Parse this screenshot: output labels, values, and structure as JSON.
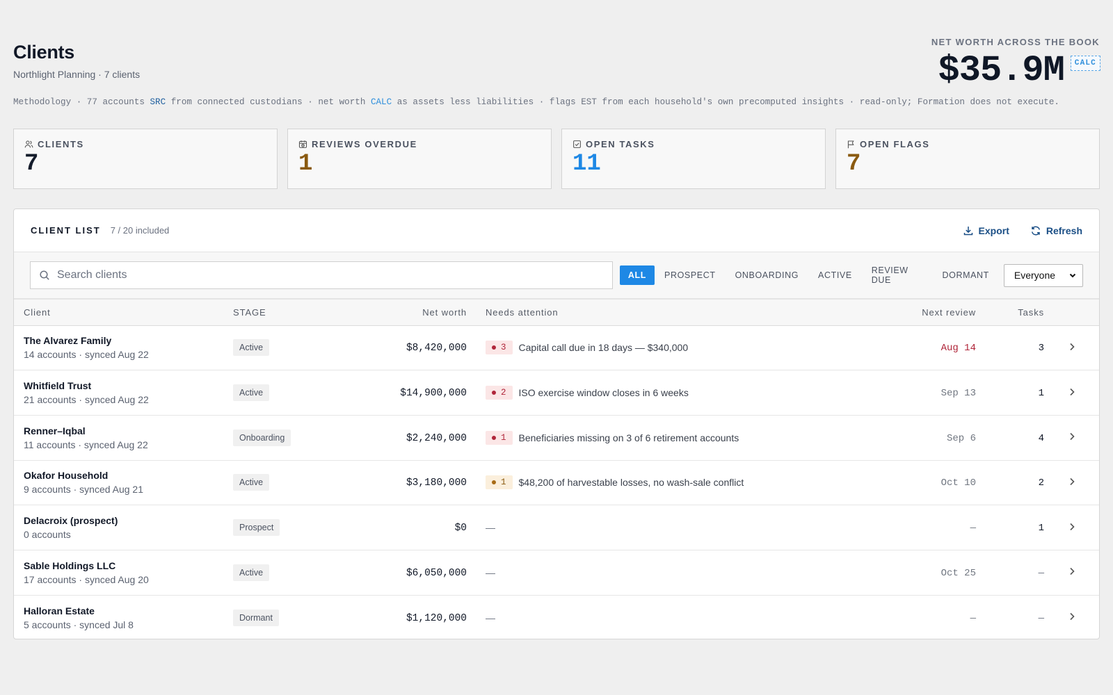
{
  "header": {
    "title": "Clients",
    "subtitle": "Northlight Planning · 7 clients",
    "hero_label": "NET WORTH ACROSS THE BOOK",
    "hero_value": "$35.9M",
    "hero_badge": "CALC"
  },
  "methodology": {
    "part1": "Methodology · 77 accounts ",
    "src": "SRC",
    "part2": " from connected custodians · net worth ",
    "calc": "CALC",
    "part3": " as assets less liabilities · flags EST from each household's own precomputed insights · read-only; Formation does not execute."
  },
  "kpis": [
    {
      "label": "CLIENTS",
      "value": "7",
      "icon": "people-icon",
      "color": "#111827"
    },
    {
      "label": "REVIEWS OVERDUE",
      "value": "1",
      "icon": "calendar-clock-icon",
      "color": "#8a5a10"
    },
    {
      "label": "OPEN TASKS",
      "value": "11",
      "icon": "checkbox-icon",
      "color": "#1e88e5"
    },
    {
      "label": "OPEN FLAGS",
      "value": "7",
      "icon": "flag-icon",
      "color": "#8a5a10"
    }
  ],
  "client_list": {
    "title": "CLIENT LIST",
    "count": "7 / 20 included",
    "export_label": "Export",
    "refresh_label": "Refresh",
    "search_placeholder": "Search clients",
    "filters": [
      "ALL",
      "PROSPECT",
      "ONBOARDING",
      "ACTIVE",
      "REVIEW DUE",
      "DORMANT"
    ],
    "active_filter": "ALL",
    "owner_select": "Everyone",
    "columns": {
      "client": "Client",
      "stage": "STAGE",
      "net_worth": "Net worth",
      "needs": "Needs attention",
      "review": "Next review",
      "tasks": "Tasks"
    },
    "rows": [
      {
        "name": "The Alvarez Family",
        "meta": "14 accounts · synced Aug 22",
        "stage": "Active",
        "net_worth": "$8,420,000",
        "flag_count": "3",
        "flag_level": "red",
        "attention": "Capital call due in 18 days — $340,000",
        "review": "Aug 14",
        "review_overdue": true,
        "tasks": "3"
      },
      {
        "name": "Whitfield Trust",
        "meta": "21 accounts · synced Aug 22",
        "stage": "Active",
        "net_worth": "$14,900,000",
        "flag_count": "2",
        "flag_level": "red",
        "attention": "ISO exercise window closes in 6 weeks",
        "review": "Sep 13",
        "review_overdue": false,
        "tasks": "1"
      },
      {
        "name": "Renner–Iqbal",
        "meta": "11 accounts · synced Aug 22",
        "stage": "Onboarding",
        "net_worth": "$2,240,000",
        "flag_count": "1",
        "flag_level": "red",
        "attention": "Beneficiaries missing on 3 of 6 retirement accounts",
        "review": "Sep 6",
        "review_overdue": false,
        "tasks": "4"
      },
      {
        "name": "Okafor Household",
        "meta": "9 accounts · synced Aug 21",
        "stage": "Active",
        "net_worth": "$3,180,000",
        "flag_count": "1",
        "flag_level": "amber",
        "attention": "$48,200 of harvestable losses, no wash-sale conflict",
        "review": "Oct 10",
        "review_overdue": false,
        "tasks": "2"
      },
      {
        "name": "Delacroix (prospect)",
        "meta": "0 accounts",
        "stage": "Prospect",
        "net_worth": "$0",
        "flag_count": "",
        "flag_level": "",
        "attention": "—",
        "review": "—",
        "review_overdue": false,
        "tasks": "1"
      },
      {
        "name": "Sable Holdings LLC",
        "meta": "17 accounts · synced Aug 20",
        "stage": "Active",
        "net_worth": "$6,050,000",
        "flag_count": "",
        "flag_level": "",
        "attention": "—",
        "review": "Oct 25",
        "review_overdue": false,
        "tasks": "—"
      },
      {
        "name": "Halloran Estate",
        "meta": "5 accounts · synced Jul 8",
        "stage": "Dormant",
        "net_worth": "$1,120,000",
        "flag_count": "",
        "flag_level": "",
        "attention": "—",
        "review": "—",
        "review_overdue": false,
        "tasks": "—"
      }
    ]
  }
}
